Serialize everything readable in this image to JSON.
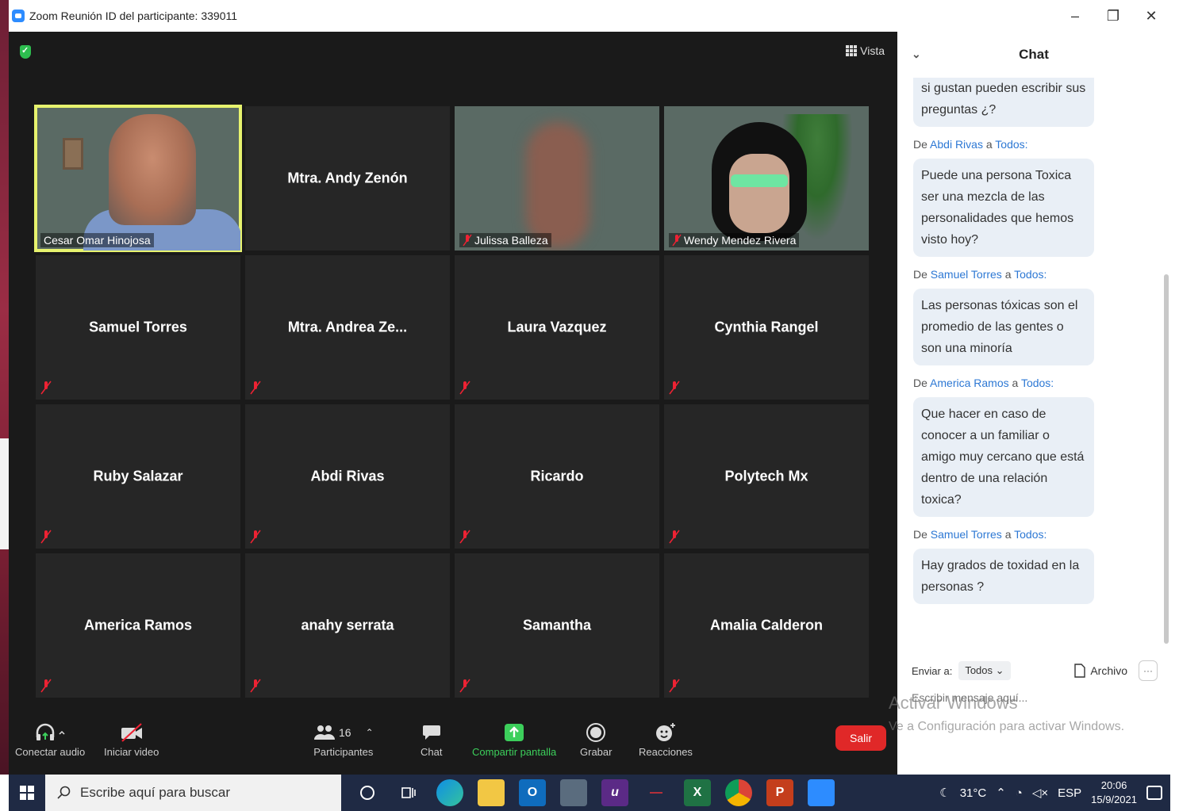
{
  "window": {
    "title": "Zoom Reunión ID del participante: 339011",
    "minimize": "–",
    "maximize": "❐",
    "close": "✕"
  },
  "meeting": {
    "view_label": "Vista",
    "tiles": [
      {
        "name": "Cesar Omar Hinojosa",
        "type": "video",
        "active": true,
        "muted": false
      },
      {
        "name": "Mtra. Andy Zenón",
        "type": "name",
        "muted": false
      },
      {
        "name": "Julissa Balleza",
        "type": "video",
        "muted": true
      },
      {
        "name": "Wendy Mendez Rivera",
        "type": "video",
        "muted": true
      },
      {
        "name": "Samuel Torres",
        "type": "name",
        "muted": true
      },
      {
        "name": "Mtra. Andrea Ze...",
        "type": "name",
        "muted": true
      },
      {
        "name": "Laura Vazquez",
        "type": "name",
        "muted": true
      },
      {
        "name": "Cynthia Rangel",
        "type": "name",
        "muted": true
      },
      {
        "name": "Ruby Salazar",
        "type": "name",
        "muted": true
      },
      {
        "name": "Abdi Rivas",
        "type": "name",
        "muted": true
      },
      {
        "name": "Ricardo",
        "type": "name",
        "muted": true
      },
      {
        "name": "Polytech Mx",
        "type": "name",
        "muted": true
      },
      {
        "name": "America Ramos",
        "type": "name",
        "muted": true
      },
      {
        "name": "anahy serrata",
        "type": "name",
        "muted": true
      },
      {
        "name": "Samantha",
        "type": "name",
        "muted": true
      },
      {
        "name": "Amalia Calderon",
        "type": "name",
        "muted": true
      }
    ]
  },
  "toolbar": {
    "audio_label": "Conectar audio",
    "video_label": "Iniciar video",
    "participants_label": "Participantes",
    "participants_count": "16",
    "chat_label": "Chat",
    "share_label": "Compartir pantalla",
    "record_label": "Grabar",
    "reactions_label": "Reacciones",
    "leave_label": "Salir"
  },
  "chat": {
    "title": "Chat",
    "from_prefix": "De",
    "to_connector": "a",
    "to_everyone": "Todos:",
    "first_message": "si gustan pueden escribir sus preguntas ¿?",
    "messages": [
      {
        "sender": "Abdi Rivas",
        "text": "Puede una persona Toxica ser una mezcla de las personalidades que hemos visto hoy?"
      },
      {
        "sender": "Samuel Torres",
        "text": "Las personas tóxicas son el promedio de las gentes o son una minoría"
      },
      {
        "sender": "America Ramos",
        "text": "Que hacer en caso de conocer a un familiar o amigo muy cercano que está dentro de una relación toxica?"
      },
      {
        "sender": "Samuel Torres",
        "text": "Hay grados de toxidad en la personas ?"
      }
    ],
    "send_to_label": "Enviar a:",
    "send_to_value": "Todos",
    "file_label": "Archivo",
    "more_label": "···",
    "input_placeholder": "Escribir mensaje aquí..."
  },
  "watermark": {
    "line1": "Activar Windows",
    "line2": "Ve a Configuración para activar Windows."
  },
  "taskbar": {
    "search_placeholder": "Escribe aquí para buscar",
    "weather": "31°C",
    "language": "ESP",
    "time": "20:06",
    "date": "15/9/2021"
  }
}
